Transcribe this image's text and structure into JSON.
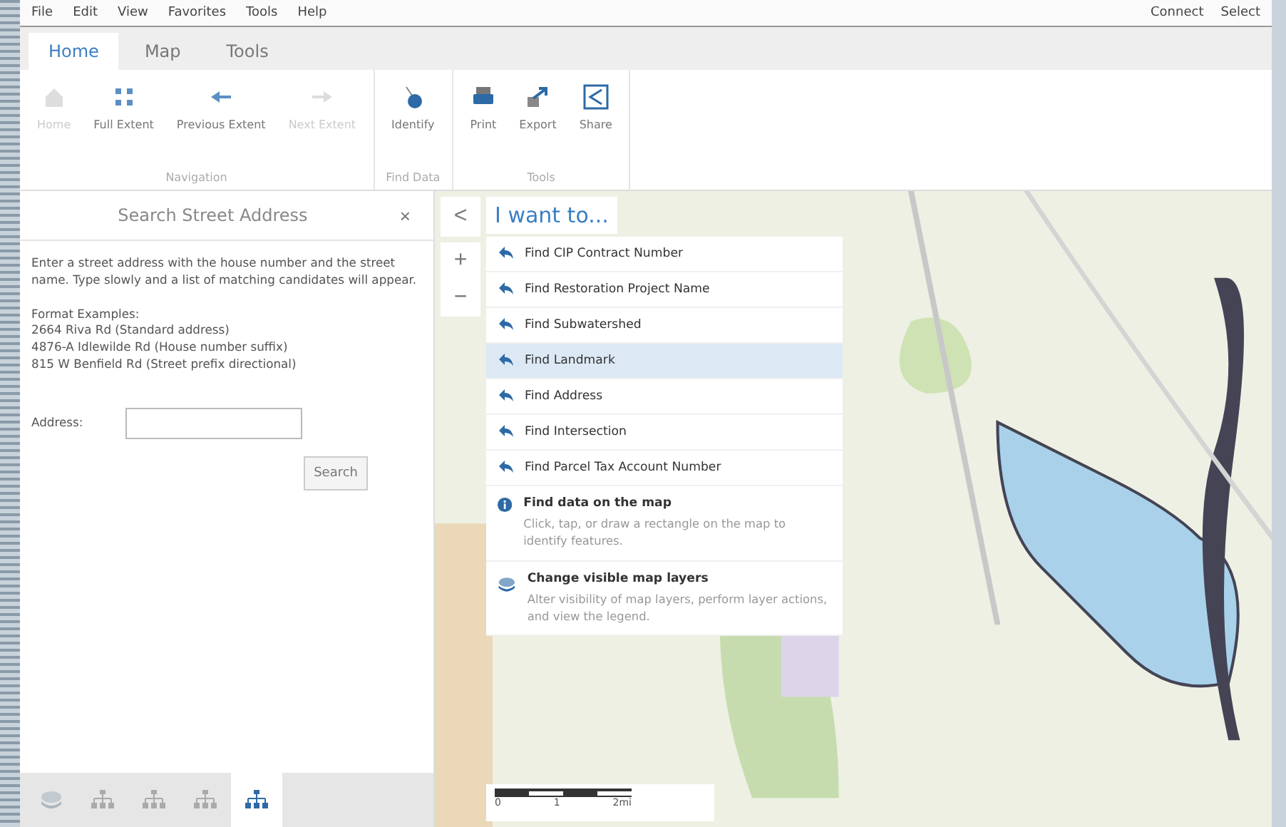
{
  "menu_bar": {
    "items": [
      "File",
      "Edit",
      "View",
      "Favorites",
      "Tools",
      "Help"
    ],
    "right": [
      "Connect",
      "Select"
    ]
  },
  "tabs": [
    {
      "label": "Home",
      "selected": true
    },
    {
      "label": "Map",
      "selected": false
    },
    {
      "label": "Tools",
      "selected": false
    }
  ],
  "ribbon": {
    "groups": [
      {
        "label": "Navigation",
        "buttons": [
          {
            "label": "Home",
            "kind": "home",
            "disabled": true
          },
          {
            "label": "Full Extent",
            "kind": "extent",
            "disabled": false
          },
          {
            "label": "Previous Extent",
            "kind": "back",
            "disabled": false
          },
          {
            "label": "Next Extent",
            "kind": "forward",
            "disabled": true
          }
        ]
      },
      {
        "label": "Find Data",
        "buttons": [
          {
            "label": "Identify",
            "kind": "identify",
            "disabled": false
          }
        ]
      },
      {
        "label": "Tools",
        "buttons": [
          {
            "label": "Print",
            "kind": "print",
            "disabled": false
          },
          {
            "label": "Export",
            "kind": "export",
            "disabled": false
          },
          {
            "label": "Share",
            "kind": "share",
            "disabled": false
          }
        ]
      }
    ]
  },
  "panel": {
    "title": "Search Street Address",
    "close": "×",
    "intro": "Enter a street address with the house number and the street name. Type slowly and a list of matching candidates will appear.",
    "examples_title": "Format Examples:",
    "examples": [
      "2664 Riva Rd (Standard address)",
      "4876-A Idlewilde Rd (House number suffix)",
      "815 W Benfield Rd (Street prefix directional)"
    ],
    "address_label": "Address:",
    "search_button": "Search",
    "bottom_tabs": [
      {
        "kind": "layers",
        "selected": false
      },
      {
        "kind": "tree",
        "selected": false
      },
      {
        "kind": "tree",
        "selected": false
      },
      {
        "kind": "tree",
        "selected": false
      },
      {
        "kind": "tree",
        "selected": true
      }
    ]
  },
  "map": {
    "collapse": "<",
    "zoom_in": "+",
    "zoom_out": "−",
    "scale_labels": [
      "0",
      "1",
      "2mi"
    ],
    "i_want_to": {
      "title": "I want to...",
      "items": [
        {
          "kind": "find",
          "label": "Find CIP Contract Number",
          "selected": false
        },
        {
          "kind": "find",
          "label": "Find Restoration Project Name",
          "selected": false
        },
        {
          "kind": "find",
          "label": "Find Subwatershed",
          "selected": false
        },
        {
          "kind": "find",
          "label": "Find Landmark",
          "selected": true
        },
        {
          "kind": "find",
          "label": "Find Address",
          "selected": false
        },
        {
          "kind": "find",
          "label": "Find Intersection",
          "selected": false
        },
        {
          "kind": "find",
          "label": "Find Parcel Tax Account Number",
          "selected": false
        },
        {
          "kind": "identify",
          "label": "Find data on the map",
          "description": "Click, tap, or draw a rectangle on the map to identify features.",
          "selected": false
        },
        {
          "kind": "layers",
          "label": "Change visible map layers",
          "description": "Alter visibility of map layers, perform layer actions, and view the legend.",
          "selected": false
        }
      ]
    }
  }
}
